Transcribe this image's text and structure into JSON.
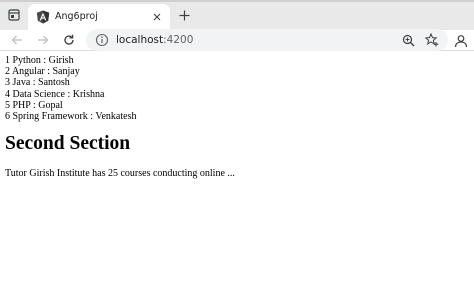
{
  "browser": {
    "tab": {
      "title": "Ang6proj"
    },
    "address_bar": {
      "host": "localhost",
      "port": ":4200"
    }
  },
  "colors": {
    "tabstrip_bg": "#e9e9e9",
    "omnibox_bg": "#f1f3f4",
    "angular_red": "#dd0031",
    "icon_gray": "#5f6368"
  },
  "icons": {
    "tab_actions": "tab-actions-icon",
    "tab_favicon": "angular-logo-icon",
    "tab_close": "close-icon",
    "new_tab": "plus-icon",
    "back": "arrow-left-icon",
    "forward": "arrow-right-icon",
    "reload": "reload-icon",
    "site_info": "info-icon",
    "zoom": "zoom-icon",
    "favorite": "star-plus-icon",
    "profile": "profile-icon"
  },
  "content": {
    "courses": [
      "1 Python : Girish",
      "2 Angular : Sanjay",
      "3 Java : Santosh",
      "4 Data Science : Krishna",
      "5 PHP : Gopal",
      "6 Spring Framework : Venkatesh"
    ],
    "section_title": "Second Section",
    "section_text": "Tutor Girish Institute has 25 courses conducting online ..."
  }
}
